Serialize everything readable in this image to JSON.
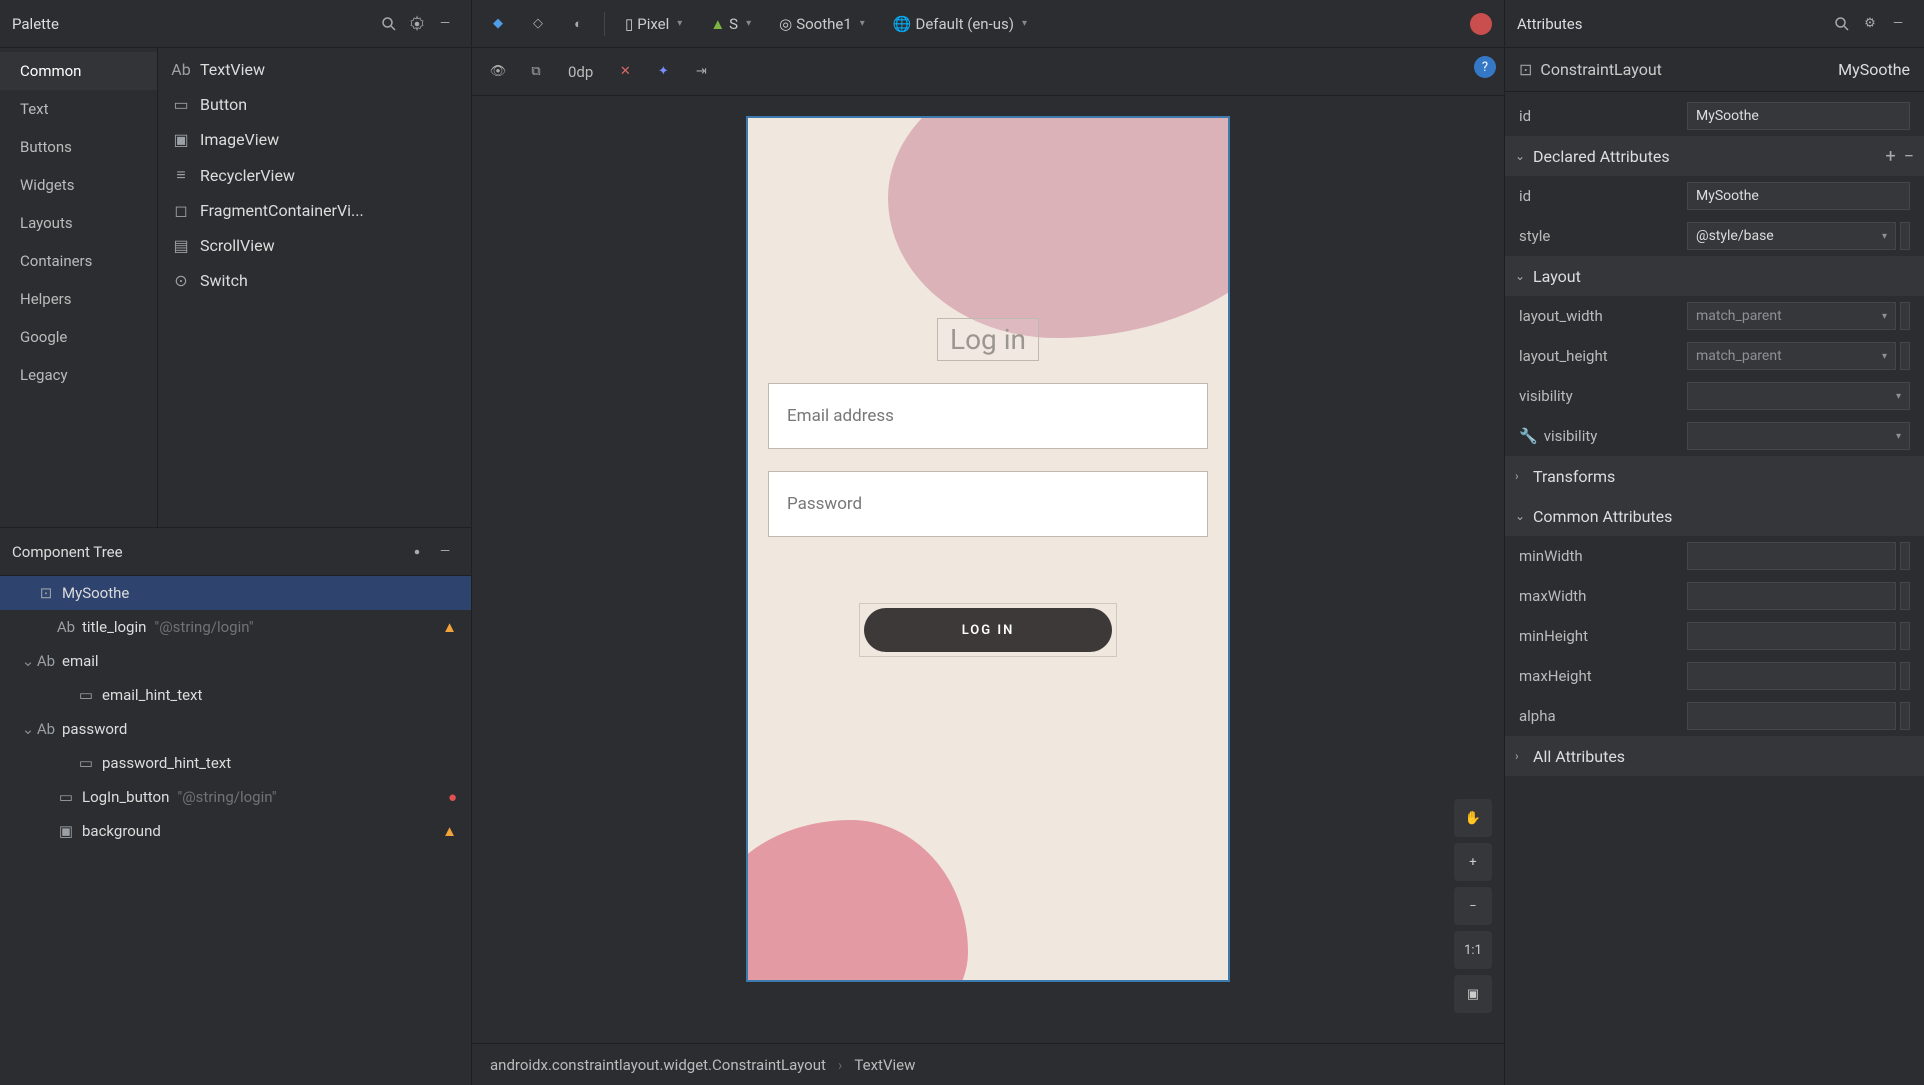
{
  "palette": {
    "title": "Palette",
    "categories": [
      "Common",
      "Text",
      "Buttons",
      "Widgets",
      "Layouts",
      "Containers",
      "Helpers",
      "Google",
      "Legacy"
    ],
    "selected_category": "Common",
    "items": [
      {
        "icon": "Ab",
        "label": "TextView"
      },
      {
        "icon": "rect",
        "label": "Button"
      },
      {
        "icon": "image",
        "label": "ImageView"
      },
      {
        "icon": "list",
        "label": "RecyclerView"
      },
      {
        "icon": "frag",
        "label": "FragmentContainerVi..."
      },
      {
        "icon": "scroll",
        "label": "ScrollView"
      },
      {
        "icon": "switch",
        "label": "Switch"
      }
    ]
  },
  "component_tree": {
    "title": "Component Tree",
    "rows": [
      {
        "level": 0,
        "chev": "",
        "icon": "layout",
        "name": "MySoothe",
        "hint": "",
        "status": "",
        "selected": true
      },
      {
        "level": 1,
        "chev": "",
        "icon": "Ab",
        "name": "title_login",
        "hint": "\"@string/login\"",
        "status": "warn"
      },
      {
        "level": 1,
        "chev": "v",
        "icon": "Ab",
        "name": "email",
        "hint": "",
        "status": ""
      },
      {
        "level": 2,
        "chev": "",
        "icon": "field",
        "name": "email_hint_text",
        "hint": "",
        "status": ""
      },
      {
        "level": 1,
        "chev": "v",
        "icon": "Ab",
        "name": "password",
        "hint": "",
        "status": ""
      },
      {
        "level": 2,
        "chev": "",
        "icon": "field",
        "name": "password_hint_text",
        "hint": "",
        "status": ""
      },
      {
        "level": 1,
        "chev": "",
        "icon": "rect",
        "name": "LogIn_button",
        "hint": "\"@string/login\"",
        "status": "err"
      },
      {
        "level": 1,
        "chev": "",
        "icon": "image",
        "name": "background",
        "hint": "",
        "status": "warn"
      }
    ]
  },
  "toolbar": {
    "device": "Pixel",
    "api": "S",
    "theme": "Soothe1",
    "locale": "Default (en-us)",
    "odp": "0dp"
  },
  "preview": {
    "title": "Log in",
    "email_hint": "Email address",
    "password_hint": "Password",
    "button": "LOG IN"
  },
  "side_controls": {
    "ratio": "1:1"
  },
  "breadcrumb": {
    "a": "androidx.constraintlayout.widget.ConstraintLayout",
    "b": "TextView"
  },
  "attributes": {
    "title": "Attributes",
    "type": "ConstraintLayout",
    "name": "MySoothe",
    "id_label": "id",
    "id_value": "MySoothe",
    "sections": {
      "declared": "Declared Attributes",
      "layout": "Layout",
      "transforms": "Transforms",
      "common": "Common Attributes",
      "all": "All Attributes"
    },
    "declared": [
      {
        "label": "id",
        "value": "MySoothe",
        "dd": false
      },
      {
        "label": "style",
        "value": "@style/base",
        "dd": true
      }
    ],
    "layout": [
      {
        "label": "layout_width",
        "value": "match_parent",
        "dd": true
      },
      {
        "label": "layout_height",
        "value": "match_parent",
        "dd": true
      },
      {
        "label": "visibility",
        "value": "",
        "dd": true
      },
      {
        "label": "visibility",
        "value": "",
        "dd": true,
        "wrench": true
      }
    ],
    "common": [
      {
        "label": "minWidth",
        "value": ""
      },
      {
        "label": "maxWidth",
        "value": ""
      },
      {
        "label": "minHeight",
        "value": ""
      },
      {
        "label": "maxHeight",
        "value": ""
      },
      {
        "label": "alpha",
        "value": ""
      }
    ]
  }
}
